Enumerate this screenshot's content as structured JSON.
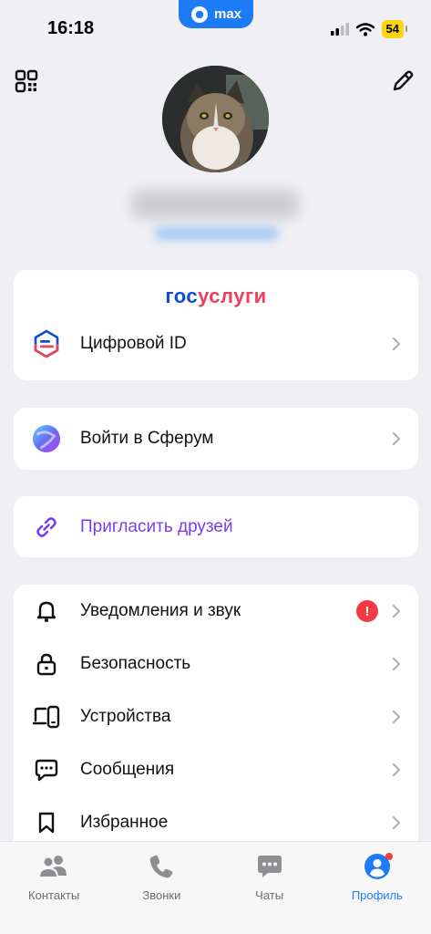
{
  "status": {
    "time": "16:18",
    "app_name": "max",
    "battery": "54"
  },
  "gosuslugi": {
    "logo_part1": "гос",
    "logo_part2": "услуги",
    "digital_id_label": "Цифровой ID"
  },
  "sferum": {
    "label": "Войти в Сферум"
  },
  "invite": {
    "label": "Пригласить друзей"
  },
  "settings": {
    "items": [
      {
        "label": "Уведомления и звук",
        "icon": "bell-icon",
        "badge": "!"
      },
      {
        "label": "Безопасность",
        "icon": "lock-icon"
      },
      {
        "label": "Устройства",
        "icon": "devices-icon"
      },
      {
        "label": "Сообщения",
        "icon": "message-icon"
      },
      {
        "label": "Избранное",
        "icon": "bookmark-icon"
      }
    ]
  },
  "tabs": [
    {
      "label": "Контакты",
      "icon": "contacts-icon"
    },
    {
      "label": "Звонки",
      "icon": "phone-icon"
    },
    {
      "label": "Чаты",
      "icon": "chat-icon"
    },
    {
      "label": "Профиль",
      "icon": "profile-icon",
      "active": true
    }
  ],
  "colors": {
    "accent": "#1d7bf5",
    "invite": "#7a3cf0",
    "alert": "#f33a42",
    "background": "#efeff4"
  }
}
